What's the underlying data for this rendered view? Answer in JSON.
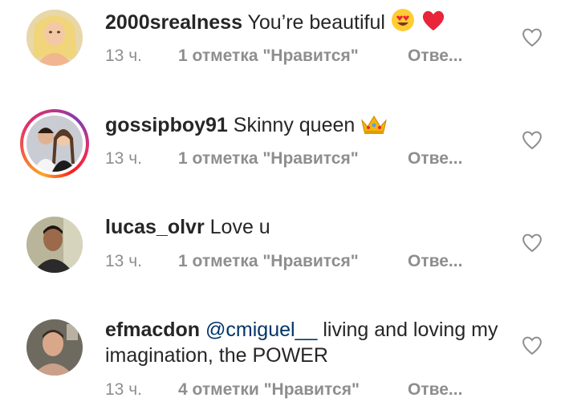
{
  "comments": [
    {
      "username": "2000srealness",
      "text": "You’re beautiful",
      "emojis": [
        "heart-eyes-emoji",
        "red-heart-emoji"
      ],
      "time": "13 ч.",
      "likes": "1 отметка \"Нравится\"",
      "reply": "Отве..."
    },
    {
      "username": "gossipboy91",
      "text": "Skinny queen",
      "emojis": [
        "crown-emoji"
      ],
      "time": "13 ч.",
      "likes": "1 отметка \"Нравится\"",
      "reply": "Отве..."
    },
    {
      "username": "lucas_olvr",
      "text": "Love u",
      "time": "13 ч.",
      "likes": "1 отметка \"Нравится\"",
      "reply": "Отве..."
    },
    {
      "username": "efmacdon",
      "mention": "@cmiguel__",
      "text": "living and loving my imagination, the POWER",
      "time": "13 ч.",
      "likes": "4 отметки \"Нравится\"",
      "reply": "Отве..."
    }
  ],
  "colors": {
    "text": "#262626",
    "secondary": "#8e8e8e",
    "mention": "#003569",
    "heart_outline": "#8e8e8e"
  }
}
